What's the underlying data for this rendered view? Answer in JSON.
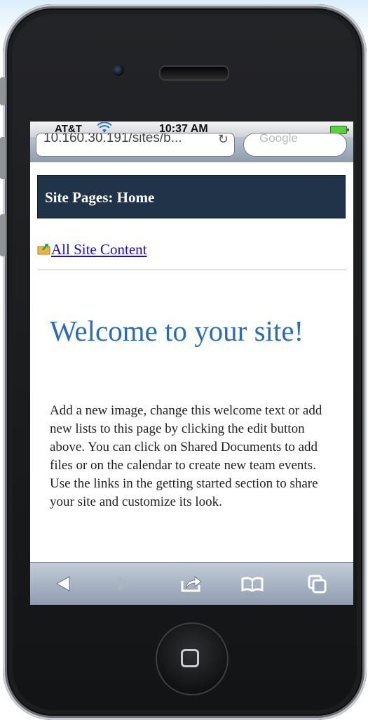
{
  "status_bar": {
    "carrier": "AT&T",
    "time": "10:37 AM",
    "wifi_icon": "wifi-icon",
    "battery_icon": "battery-icon",
    "battery_color": "#55d43a"
  },
  "browser": {
    "url": "10.160.30.191/sites/b...",
    "search_placeholder": "Google"
  },
  "site": {
    "header_title": "Site Pages: Home",
    "nav_link": "All Site Content",
    "welcome_heading": "Welcome to your site!",
    "body": "Add a new image, change this welcome text or add new lists to this page by clicking the edit button above. You can click on Shared Documents to add files or on the calendar to create new team events. Use the links in the getting started section to share your site and customize its look."
  },
  "colors": {
    "header_bg": "#213348",
    "heading": "#2a6db5",
    "link": "#1a0dcc"
  },
  "toolbar": {
    "icons": [
      "back-icon",
      "forward-icon",
      "share-icon",
      "bookmarks-icon",
      "tabs-icon"
    ]
  }
}
